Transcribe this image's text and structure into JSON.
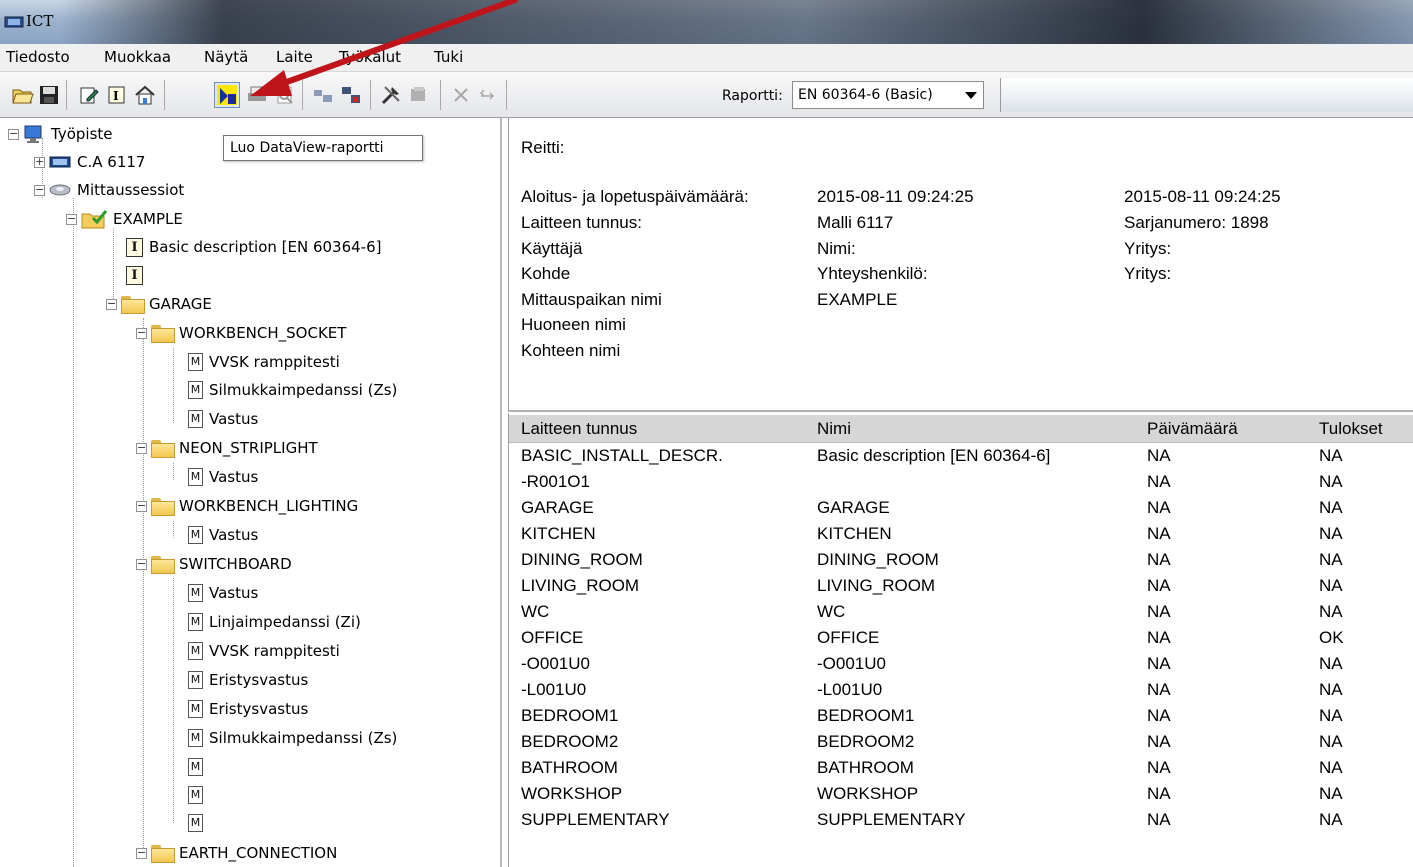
{
  "window": {
    "title": "ICT"
  },
  "menu": [
    "Tiedosto",
    "Muokkaa",
    "Näytä",
    "Laite",
    "Työkalut",
    "Tuki"
  ],
  "toolbar": {
    "report_label": "Raportti:",
    "report_value": "EN 60364-6 (Basic)",
    "tooltip": "Luo DataView-raportti"
  },
  "tree": {
    "root": "Työpiste",
    "device": "C.A 6117",
    "sessions": "Mittaussessiot",
    "example": "EXAMPLE",
    "basic": "Basic description [EN 60364-6]",
    "garage": "GARAGE",
    "workbench_socket": "WORKBENCH_SOCKET",
    "vvsk1": "VVSK ramppitesti",
    "silmukka1": "Silmukkaimpedanssi (Zs)",
    "vastus1": "Vastus",
    "neon": "NEON_STRIPLIGHT",
    "vastus2": "Vastus",
    "workbench_lighting": "WORKBENCH_LIGHTING",
    "vastus3": "Vastus",
    "switchboard": "SWITCHBOARD",
    "vastus4": "Vastus",
    "linja": "Linjaimpedanssi (Zi)",
    "vvsk2": "VVSK ramppitesti",
    "eristys1": "Eristysvastus",
    "eristys2": "Eristysvastus",
    "silmukka2": "Silmukkaimpedanssi (Zs)",
    "earth": "EARTH_CONNECTION"
  },
  "details": {
    "route": "Reitti:",
    "date_label": "Aloitus- ja lopetuspäivämäärä:",
    "date_start": "2015-08-11 09:24:25",
    "date_end": "2015-08-11 09:24:25",
    "device_label": "Laitteen tunnus:",
    "device_model": "Malli 6117",
    "serial": "Sarjanumero: 1898",
    "user_label": "Käyttäjä",
    "user_name": "Nimi:",
    "user_company": "Yritys:",
    "target_label": "Kohde",
    "target_contact": "Yhteyshenkilö:",
    "target_company": "Yritys:",
    "site_label": "Mittauspaikan nimi",
    "site_value": "EXAMPLE",
    "room_label": "Huoneen nimi",
    "object_label": "Kohteen nimi"
  },
  "table": {
    "headers": [
      "Laitteen tunnus",
      "Nimi",
      "Päivämäärä",
      "Tulokset"
    ],
    "rows": [
      [
        "BASIC_INSTALL_DESCR.",
        "Basic description [EN 60364-6]",
        "NA",
        "NA"
      ],
      [
        "-R001O1",
        "",
        "NA",
        "NA"
      ],
      [
        "GARAGE",
        "GARAGE",
        "NA",
        "NA"
      ],
      [
        "KITCHEN",
        "KITCHEN",
        "NA",
        "NA"
      ],
      [
        "DINING_ROOM",
        "DINING_ROOM",
        "NA",
        "NA"
      ],
      [
        "LIVING_ROOM",
        "LIVING_ROOM",
        "NA",
        "NA"
      ],
      [
        "WC",
        "WC",
        "NA",
        "NA"
      ],
      [
        "OFFICE",
        "OFFICE",
        "NA",
        "OK"
      ],
      [
        "-O001U0",
        "-O001U0",
        "NA",
        "NA"
      ],
      [
        "-L001U0",
        "-L001U0",
        "NA",
        "NA"
      ],
      [
        "BEDROOM1",
        "BEDROOM1",
        "NA",
        "NA"
      ],
      [
        "BEDROOM2",
        "BEDROOM2",
        "NA",
        "NA"
      ],
      [
        "BATHROOM",
        "BATHROOM",
        "NA",
        "NA"
      ],
      [
        "WORKSHOP",
        "WORKSHOP",
        "NA",
        "NA"
      ],
      [
        "SUPPLEMENTARY",
        "SUPPLEMENTARY",
        "NA",
        "NA"
      ]
    ]
  },
  "colors": {
    "annotation_arrow": "#c0141b",
    "selection": "#d6d6d6"
  }
}
